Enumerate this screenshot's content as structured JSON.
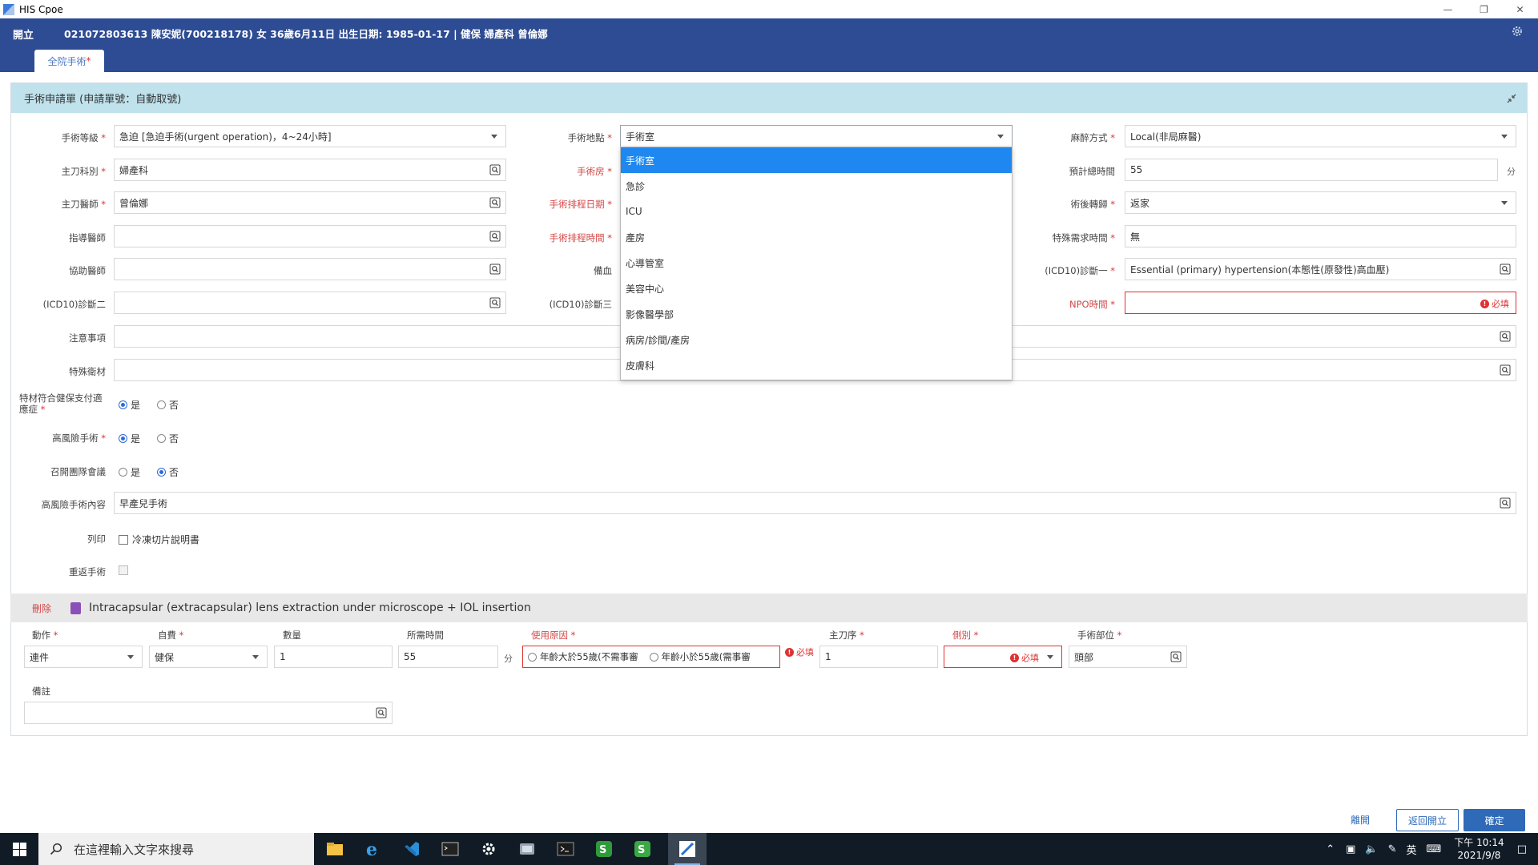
{
  "window": {
    "title": "HIS Cpoe",
    "colors": {
      "header": "#2e4c93",
      "panel_head": "#bfe2ec",
      "accent": "#1e88f0",
      "required": "#d33333"
    }
  },
  "header": {
    "open_label": "開立",
    "patient_info": "021072803613  陳安妮(700218178)  女  36歲6月11日  出生日期: 1985-01-17  |  健保  婦產科  曾倫娜",
    "tab_label": "全院手術",
    "tab_star": "*"
  },
  "panel": {
    "title": "手術申請單 (申請單號：自動取號)",
    "fields": {
      "surgery_level": {
        "label": "手術等級",
        "value": "急迫 [急迫手術(urgent operation)，4~24小時]"
      },
      "main_dept": {
        "label": "主刀科別",
        "value": "婦產科"
      },
      "main_doctor": {
        "label": "主刀醫師",
        "value": "曾倫娜"
      },
      "instructor": {
        "label": "指導醫師",
        "value": ""
      },
      "assistant": {
        "label": "協助醫師",
        "value": ""
      },
      "icd2": {
        "label": "(ICD10)診斷二",
        "value": ""
      },
      "notes": {
        "label": "注意事項",
        "value": ""
      },
      "special_material": {
        "label": "特殊衛材",
        "value": ""
      },
      "location": {
        "label": "手術地點",
        "value": "手術室"
      },
      "room": {
        "label": "手術房"
      },
      "schedule_date": {
        "label": "手術排程日期"
      },
      "schedule_time": {
        "label": "手術排程時間"
      },
      "blood": {
        "label": "備血"
      },
      "icd3": {
        "label": "(ICD10)診斷三"
      },
      "anesthesia": {
        "label": "麻醉方式",
        "value": "Local(非局麻醫)"
      },
      "est_time": {
        "label": "預計總時間",
        "value": "55",
        "unit": "分"
      },
      "post_op": {
        "label": "術後轉歸",
        "value": "返家"
      },
      "special_time": {
        "label": "特殊需求時間",
        "value": "無"
      },
      "icd1": {
        "label": "(ICD10)診斷一",
        "value": "Essential (primary) hypertension(本態性(原發性)高血壓)"
      },
      "npo": {
        "label": "NPO時間",
        "value": "",
        "required_note": "必填"
      }
    },
    "radios": {
      "insurance": {
        "label": "特材符合健保支付適應症",
        "yes": "是",
        "no": "否",
        "selected": "yes"
      },
      "high_risk": {
        "label": "高風險手術",
        "yes": "是",
        "no": "否",
        "selected": "yes"
      },
      "team_meeting": {
        "label": "召開團隊會議",
        "yes": "是",
        "no": "否",
        "selected": "no"
      }
    },
    "high_risk_content": {
      "label": "高風險手術內容",
      "value": "早產兒手術"
    },
    "print": {
      "label": "列印",
      "option": "冷凍切片說明書"
    },
    "reoperation": {
      "label": "重返手術"
    }
  },
  "location_dropdown": {
    "options": [
      "手術室",
      "急診",
      "ICU",
      "產房",
      "心導管室",
      "美容中心",
      "影像醫學部",
      "病房/診間/產房",
      "皮膚科"
    ],
    "selected_index": 0
  },
  "procedure": {
    "delete_label": "刪除",
    "name": "Intracapsular (extracapsular) lens extraction under microscope + IOL insertion",
    "columns": {
      "action": {
        "label": "動作",
        "value": "連件"
      },
      "payment": {
        "label": "自費",
        "value": "健保"
      },
      "quantity": {
        "label": "數量",
        "value": "1"
      },
      "time": {
        "label": "所需時間",
        "value": "55",
        "unit": "分"
      },
      "reason": {
        "label": "使用原因",
        "opt1": "年齡大於55歲(不需事審",
        "opt2": "年齡小於55歲(需事審",
        "required_note": "必填"
      },
      "main_order": {
        "label": "主刀序",
        "value": "1"
      },
      "side": {
        "label": "側別",
        "required_note": "必填"
      },
      "site": {
        "label": "手術部位",
        "value": "頭部"
      },
      "remark": {
        "label": "備註",
        "value": ""
      }
    }
  },
  "footer": {
    "link": "離開",
    "back": "返回開立",
    "confirm": "確定"
  },
  "taskbar": {
    "search_placeholder": "在這裡輸入文字來搜尋",
    "ime": "英",
    "time": "下午 10:14",
    "date": "2021/9/8"
  }
}
